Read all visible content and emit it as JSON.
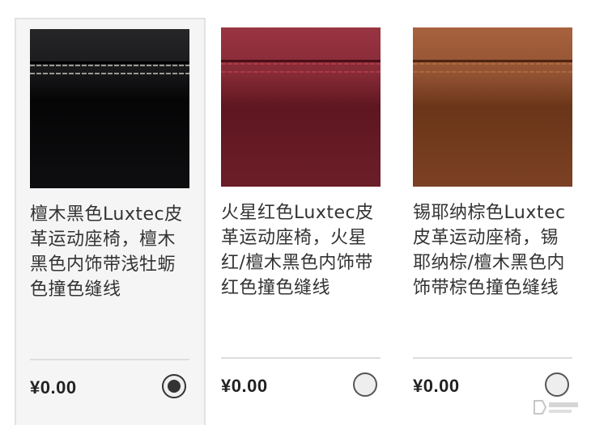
{
  "options": [
    {
      "name": "檀木黑色Luxtec皮革运动座椅，檀木黑色内饰带浅牡蛎色撞色缝线",
      "price": "¥0.00",
      "selected": true,
      "swatch_top": "#2a2a2c",
      "swatch_bottom": "#0a0a0b",
      "stitch": "#c9c6bd"
    },
    {
      "name": "火星红色Luxtec皮革运动座椅，火星红/檀木黑色内饰带红色撞色缝线",
      "price": "¥0.00",
      "selected": false,
      "swatch_top": "#9a3340",
      "swatch_bottom": "#6e1c26",
      "stitch": "#c0414e"
    },
    {
      "name": "锡耶纳棕色Luxtec皮革运动座椅，锡耶纳棕/檀木黑色内饰带棕色撞色缝线",
      "price": "¥0.00",
      "selected": false,
      "swatch_top": "#a5603c",
      "swatch_bottom": "#7a3f22",
      "stitch": "#b26d44"
    }
  ]
}
